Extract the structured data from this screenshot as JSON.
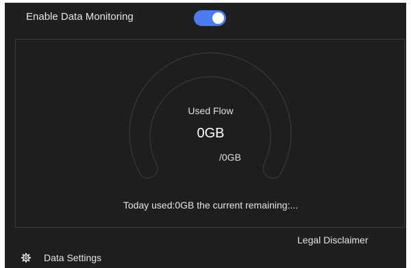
{
  "monitoring": {
    "label": "Enable Data Monitoring",
    "enabled": true
  },
  "gauge": {
    "title": "Used Flow",
    "used_value": "0GB",
    "total_value": "/0GB",
    "used_fraction": 0
  },
  "summary": {
    "text": "Today used:0GB the current remaining:..."
  },
  "footer": {
    "legal_link": "Legal Disclaimer",
    "data_settings_label": "Data Settings"
  },
  "colors": {
    "accent": "#4a7cf0",
    "background": "#1f1f1f",
    "panel_border": "#3a3a3a",
    "gauge_outline": "#3a3a3a"
  },
  "icons": {
    "data_settings": "gear-icon"
  }
}
